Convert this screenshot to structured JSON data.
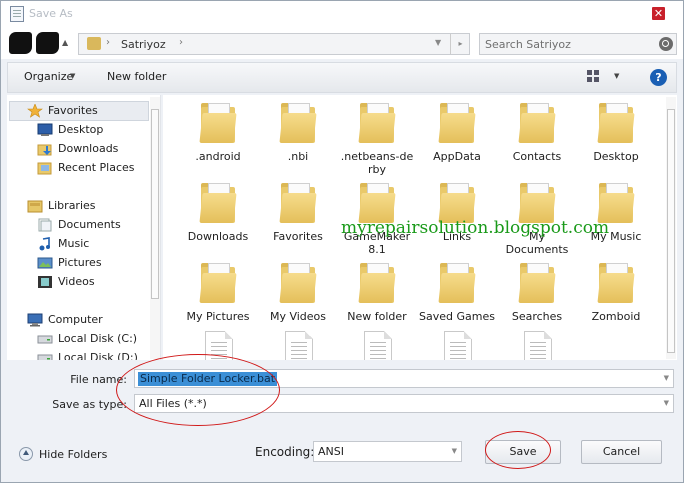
{
  "window": {
    "title": "Save As",
    "close_glyph": "✕"
  },
  "nav": {
    "recent_glyph": "▲",
    "address": {
      "location": "Satriyoz",
      "separator": "›",
      "dropdown_glyph": "▼",
      "refresh_glyph": "▸"
    },
    "search": {
      "placeholder": "Search Satriyoz"
    }
  },
  "toolbar": {
    "organize_label": "Organize",
    "new_folder_label": "New folder",
    "caret_glyph": "▼",
    "help_glyph": "?"
  },
  "sidebar": {
    "items": [
      {
        "label": "Favorites",
        "icon": "star-icon"
      },
      {
        "label": "Desktop",
        "icon": "desktop-icon"
      },
      {
        "label": "Downloads",
        "icon": "downloads-icon"
      },
      {
        "label": "Recent Places",
        "icon": "recent-places-icon"
      },
      {
        "label": "Libraries",
        "icon": "libraries-icon"
      },
      {
        "label": "Documents",
        "icon": "documents-icon"
      },
      {
        "label": "Music",
        "icon": "music-icon"
      },
      {
        "label": "Pictures",
        "icon": "pictures-icon"
      },
      {
        "label": "Videos",
        "icon": "videos-icon"
      },
      {
        "label": "Computer",
        "icon": "computer-icon"
      },
      {
        "label": "Local Disk (C:)",
        "icon": "disk-icon"
      },
      {
        "label": "Local Disk (D:)",
        "icon": "disk-icon"
      }
    ]
  },
  "files": {
    "items": [
      {
        "label": ".android",
        "kind": "folder"
      },
      {
        "label": ".nbi",
        "kind": "folder"
      },
      {
        "label": ".netbeans-de\nrby",
        "kind": "folder"
      },
      {
        "label": "AppData",
        "kind": "folder"
      },
      {
        "label": "Contacts",
        "kind": "folder"
      },
      {
        "label": "Desktop",
        "kind": "folder"
      },
      {
        "label": "Downloads",
        "kind": "folder"
      },
      {
        "label": "Favorites",
        "kind": "folder"
      },
      {
        "label": "GameMaker\n8.1",
        "kind": "folder"
      },
      {
        "label": "Links",
        "kind": "folder"
      },
      {
        "label": "My\nDocuments",
        "kind": "folder"
      },
      {
        "label": "My Music",
        "kind": "folder"
      },
      {
        "label": "My Pictures",
        "kind": "folder"
      },
      {
        "label": "My Videos",
        "kind": "folder"
      },
      {
        "label": "New folder",
        "kind": "folder"
      },
      {
        "label": "Saved Games",
        "kind": "folder"
      },
      {
        "label": "Searches",
        "kind": "folder"
      },
      {
        "label": "Zomboid",
        "kind": "folder"
      },
      {
        "label": "",
        "kind": "file"
      },
      {
        "label": "",
        "kind": "file"
      },
      {
        "label": "",
        "kind": "file"
      },
      {
        "label": "",
        "kind": "file"
      },
      {
        "label": "",
        "kind": "file"
      }
    ]
  },
  "watermark": "myrepairsolution.blogspot.com",
  "form": {
    "file_name_label": "File name:",
    "file_name_value": "Simple Folder Locker.bat",
    "save_as_type_label": "Save as type:",
    "save_as_type_value": "All Files  (*.*)",
    "caret_glyph": "▼"
  },
  "footer": {
    "hide_folders_label": "Hide Folders",
    "encoding_label": "Encoding:",
    "encoding_value": "ANSI",
    "save_label": "Save",
    "cancel_label": "Cancel"
  },
  "colors": {
    "accent": "#1a5fb4",
    "selection": "#3b8fd6",
    "annotation": "#d01818",
    "watermark": "#1a9a1a"
  }
}
